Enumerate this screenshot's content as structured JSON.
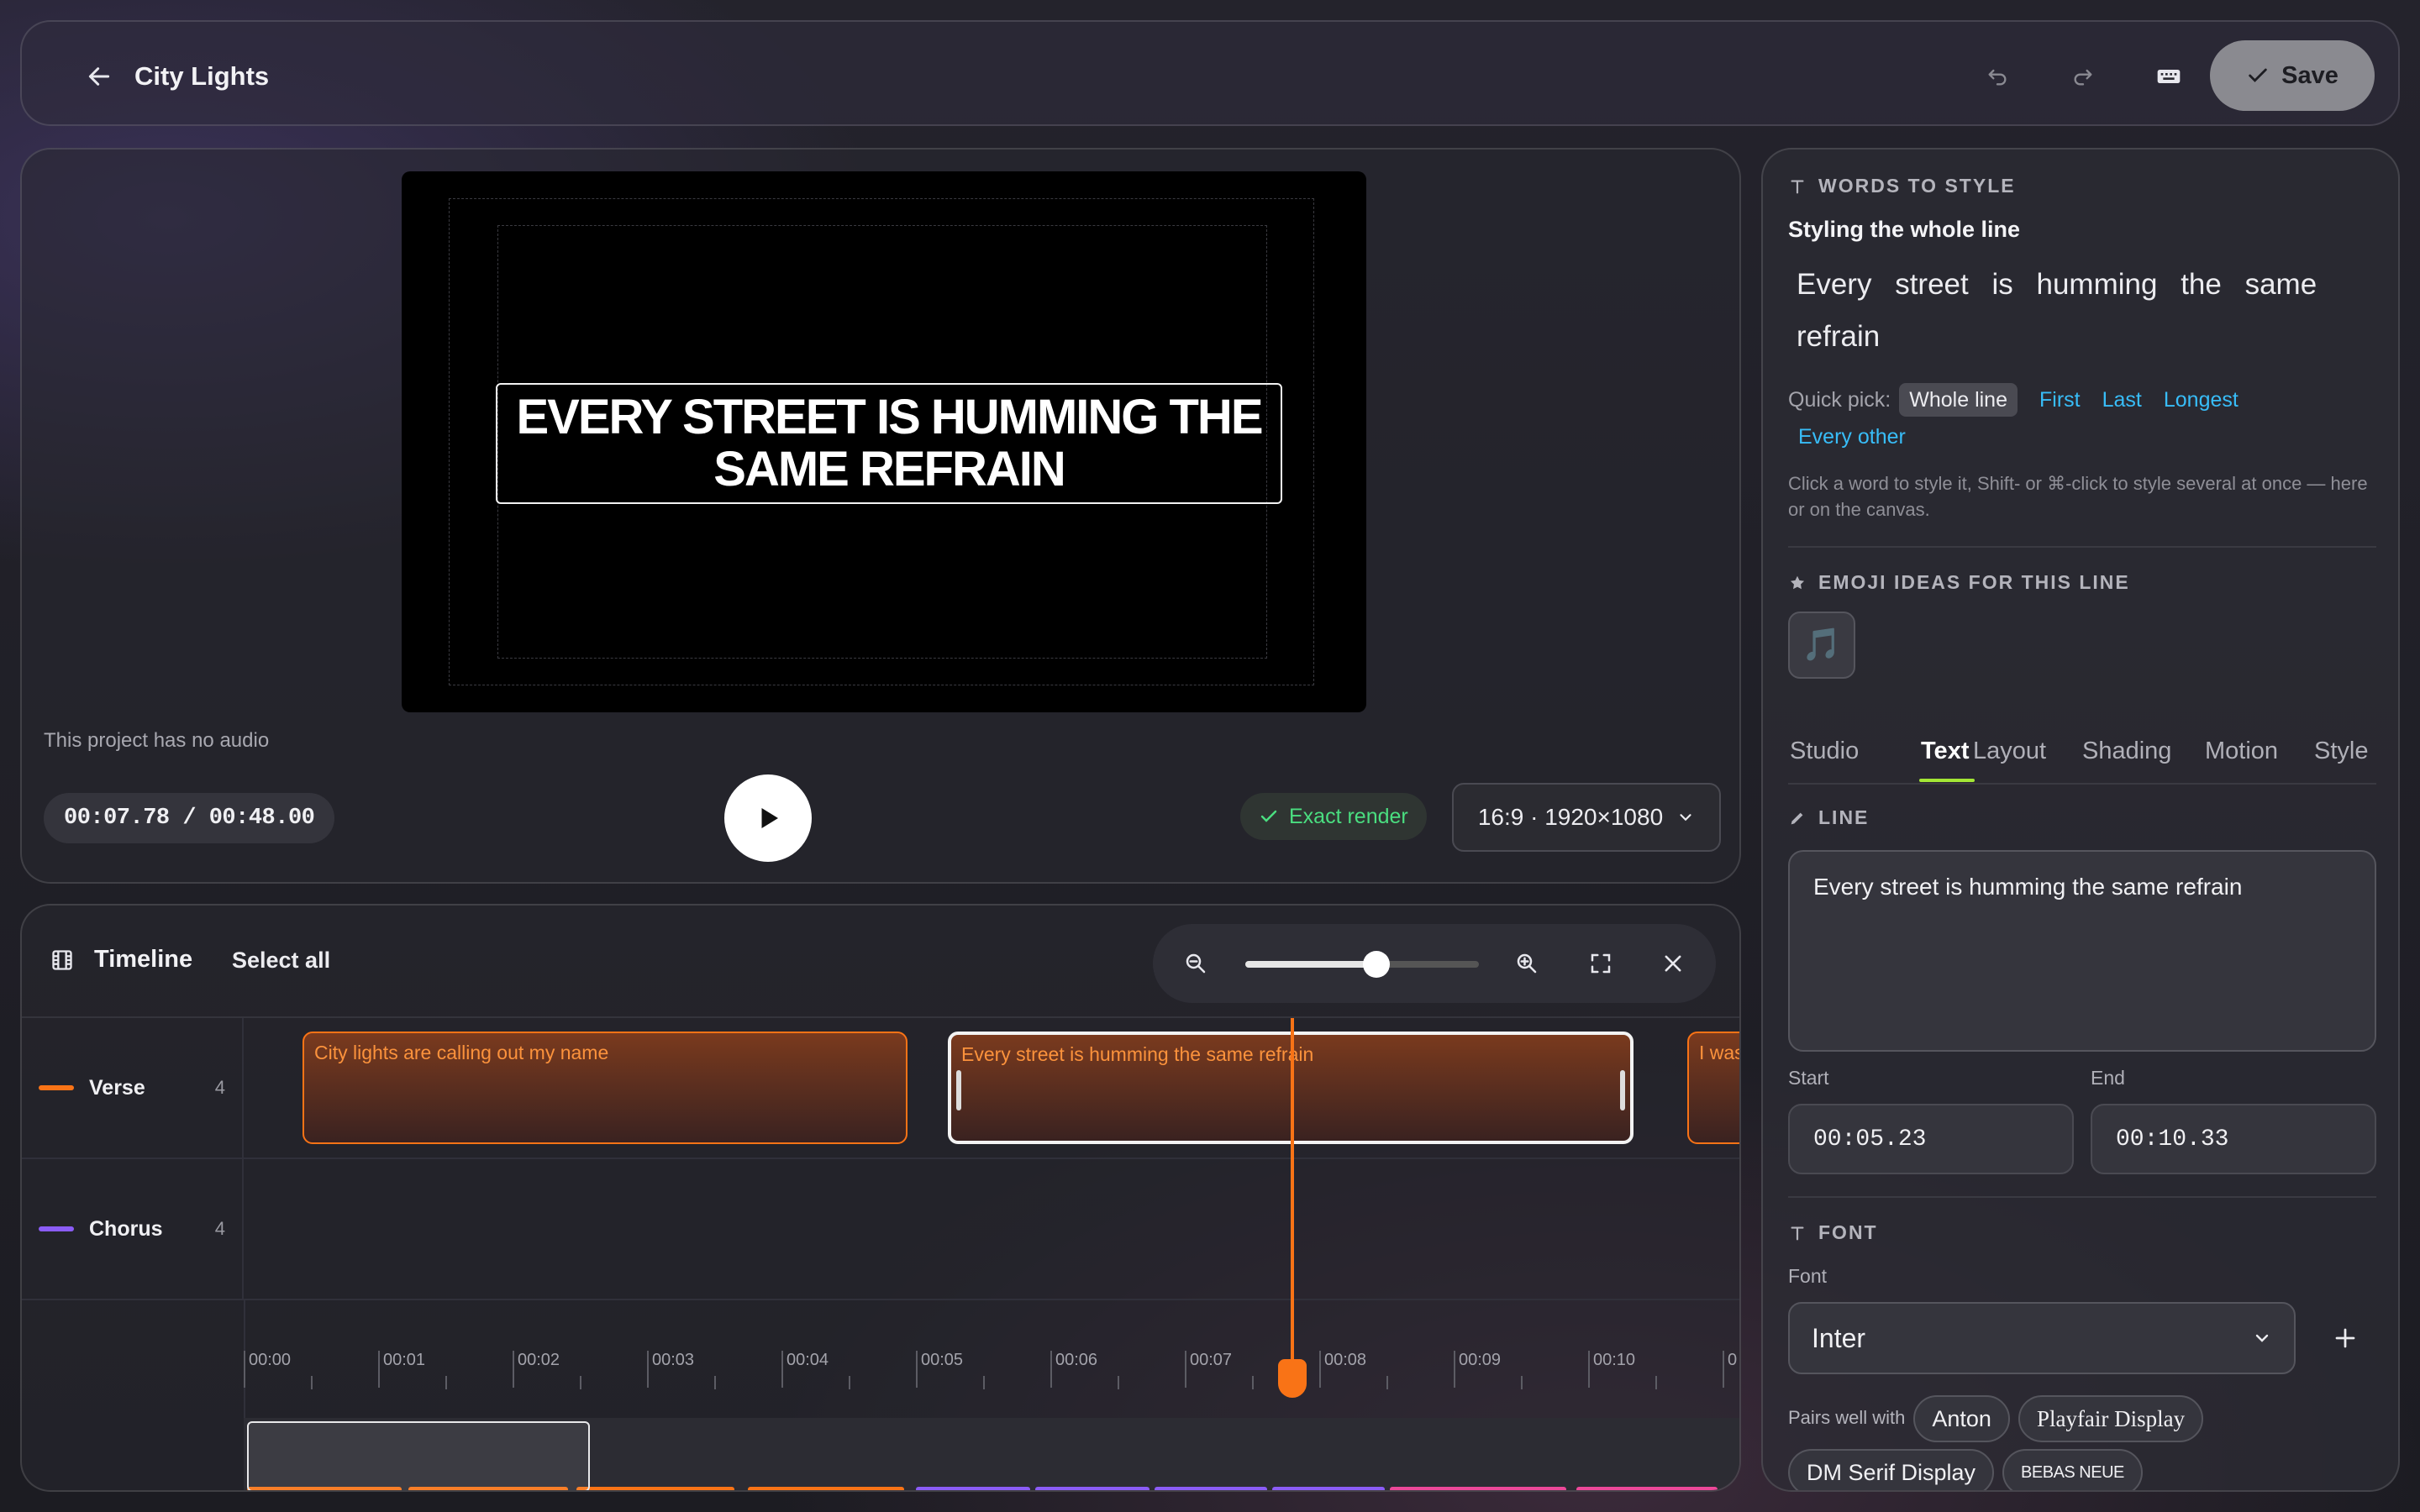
{
  "header": {
    "title": "City Lights",
    "save_label": "Save"
  },
  "preview": {
    "caption": "Every street is humming the same refrain",
    "no_audio": "This project has no audio",
    "time": "00:07.78 / 00:48.00",
    "exact_render": "Exact render",
    "aspect": "16:9 · 1920×1080"
  },
  "timeline": {
    "title": "Timeline",
    "select_all": "Select all",
    "zoom_level": 0.56,
    "lanes": [
      {
        "name": "Verse",
        "count": "4",
        "color": "#f97316"
      },
      {
        "name": "Chorus",
        "count": "4",
        "color": "#8b5cf6"
      }
    ],
    "clips": [
      {
        "text": "City lights are calling out my name"
      },
      {
        "text": "Every street is humming the same refrain"
      },
      {
        "text": "I was"
      }
    ],
    "ruler": [
      "00:00",
      "00:01",
      "00:02",
      "00:03",
      "00:04",
      "00:05",
      "00:06",
      "00:07",
      "00:08",
      "00:09",
      "00:10",
      "0"
    ]
  },
  "side": {
    "words_heading": "WORDS TO STYLE",
    "styling_label": "Styling the whole line",
    "words": [
      "Every",
      "street",
      "is",
      "humming",
      "the",
      "same",
      "refrain"
    ],
    "quick_pick_label": "Quick pick:",
    "quick_pick": {
      "active": "Whole line",
      "links": [
        "First",
        "Last",
        "Longest",
        "Every other"
      ]
    },
    "hint": "Click a word to style it, Shift- or ⌘-click to style several at once — here or on the canvas.",
    "emoji_heading": "EMOJI IDEAS FOR THIS LINE",
    "emoji": "🎵",
    "tabs": [
      "Studio",
      "Text",
      "Layout",
      "Shading",
      "Motion",
      "Style"
    ],
    "active_tab": "Text",
    "line_heading": "LINE",
    "line_text": "Every street is humming the same refrain",
    "start_label": "Start",
    "start_value": "00:05.23",
    "end_label": "End",
    "end_value": "00:10.33",
    "font_heading": "FONT",
    "font_label": "Font",
    "font_value": "Inter",
    "pairs_label": "Pairs well with",
    "pairs": [
      "Anton",
      "Playfair Display",
      "DM Serif Display",
      "BEBAS NEUE"
    ]
  },
  "colors": {
    "accent": "#f97316",
    "chorus": "#8b5cf6",
    "success": "#4ade80",
    "link": "#38bdf8",
    "tab_underline": "#a3e635"
  }
}
